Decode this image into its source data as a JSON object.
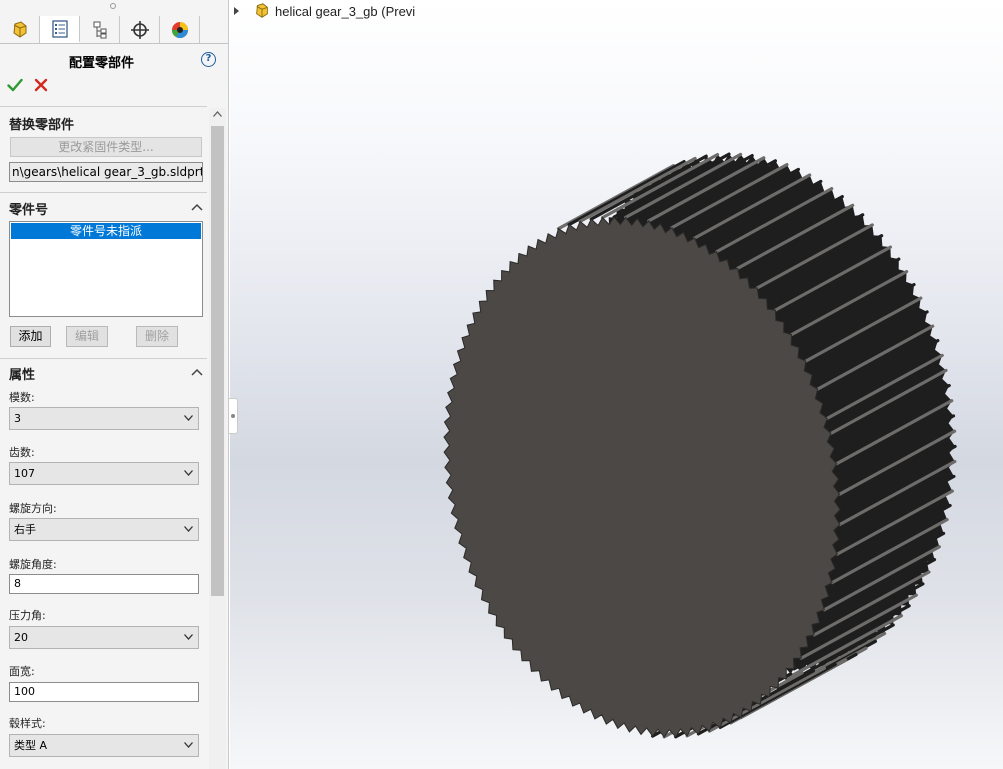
{
  "property_manager": {
    "title": "配置零部件",
    "help": "?",
    "tabs": [
      {
        "icon": "part-icon",
        "active": false
      },
      {
        "icon": "property-manager-icon",
        "active": true
      },
      {
        "icon": "configuration-manager-icon",
        "active": false
      },
      {
        "icon": "dimxpert-icon",
        "active": false
      },
      {
        "icon": "display-manager-icon",
        "active": false
      }
    ],
    "replace_group": {
      "title": "替换零部件",
      "change_button": "更改紧固件类型...",
      "file_path": "n\\gears\\helical gear_3_gb.sldprt"
    },
    "part_number_group": {
      "title": "零件号",
      "items": [
        "零件号未指派"
      ],
      "add": "添加",
      "edit": "编辑",
      "delete": "删除"
    },
    "properties_group": {
      "title": "属性",
      "module_label": "模数:",
      "module_value": "3",
      "teeth_label": "齿数:",
      "teeth_value": "107",
      "helix_dir_label": "螺旋方向:",
      "helix_dir_value": "右手",
      "helix_angle_label": "螺旋角度:",
      "helix_angle_value": "8",
      "pressure_angle_label": "压力角:",
      "pressure_angle_value": "20",
      "face_width_label": "面宽:",
      "face_width_value": "100",
      "hub_style_label": "毂样式:",
      "hub_style_value": "类型 A"
    }
  },
  "viewport": {
    "tree_title": "helical gear_3_gb (Previ",
    "colors": {
      "gear_face": "#4b4845",
      "gear_teeth_dark": "#1e1e1e",
      "gear_teeth_light": "#6d6c6a",
      "accent_blue": "#0078d7",
      "ok_green": "#2f9a2f",
      "cancel_red": "#d22a1e"
    }
  }
}
